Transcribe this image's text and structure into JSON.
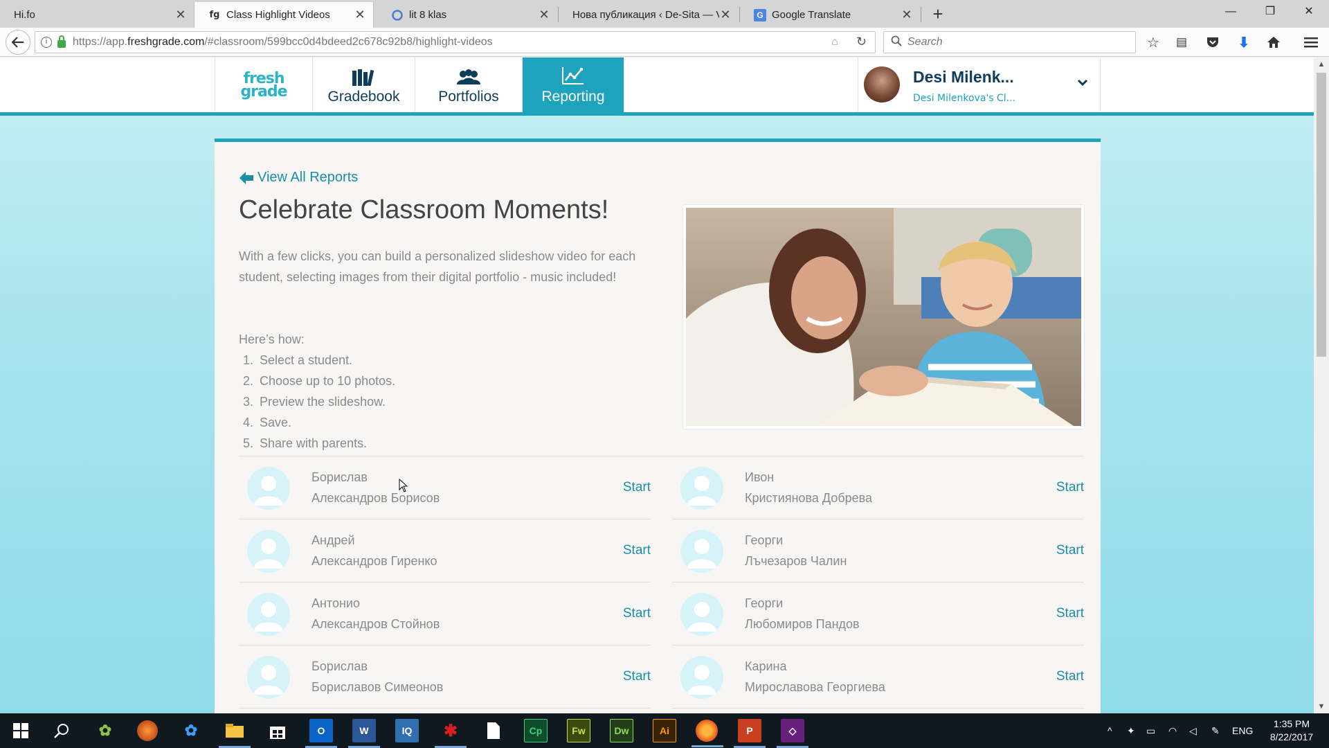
{
  "browser": {
    "tabs": [
      {
        "title": "Hi.fo",
        "active": false
      },
      {
        "title": "Class Highlight Videos",
        "active": true
      },
      {
        "title": "lit 8 klas",
        "active": false
      },
      {
        "title": "Нова публикация ‹ De-Sita — V",
        "active": false
      },
      {
        "title": "Google Translate",
        "active": false
      }
    ],
    "url_prefix": "https://app.",
    "url_domain": "freshgrade.com",
    "url_path": "/#classroom/599bcc0d4bdeed2c678c92b8/highlight-videos",
    "search_placeholder": "Search"
  },
  "app": {
    "logo_top": "fresh",
    "logo_bottom": "grade",
    "nav": [
      {
        "label": "Gradebook",
        "active": false
      },
      {
        "label": "Portfolios",
        "active": false
      },
      {
        "label": "Reporting",
        "active": true
      }
    ],
    "user": {
      "name": "Desi Milenk...",
      "class_label": "Desi Milenkova's Cl..."
    },
    "accent_color": "#1ea3bd"
  },
  "page": {
    "back_link": "View All Reports",
    "title": "Celebrate Classroom Moments!",
    "intro": "With a few clicks, you can build a personalized slideshow video for each student, selecting images from their digital portfolio - music included!",
    "howto_title": "Here’s how:",
    "steps": [
      "Select a student.",
      "Choose up to 10 photos.",
      "Preview the slideshow.",
      "Save.",
      "Share with parents."
    ],
    "start_label": "Start",
    "students": [
      {
        "first": "Борислав",
        "last": "Александров Борисов"
      },
      {
        "first": "Ивон",
        "last": "Кристиянова Добрева"
      },
      {
        "first": "Андрей",
        "last": "Александров Гиренко"
      },
      {
        "first": "Георги",
        "last": "Лъчезаров Чалин"
      },
      {
        "first": "Антонио",
        "last": "Александров Стойнов"
      },
      {
        "first": "Георги",
        "last": "Любомиров Пандов"
      },
      {
        "first": "Борислав",
        "last": "Бориславов Симеонов"
      },
      {
        "first": "Карина",
        "last": "Мирославова Георгиева"
      }
    ]
  },
  "taskbar": {
    "language": "ENG",
    "time": "1:35 PM",
    "date": "8/22/2017",
    "apps": [
      "Cp",
      "Fw",
      "Dw",
      "Ai"
    ]
  }
}
